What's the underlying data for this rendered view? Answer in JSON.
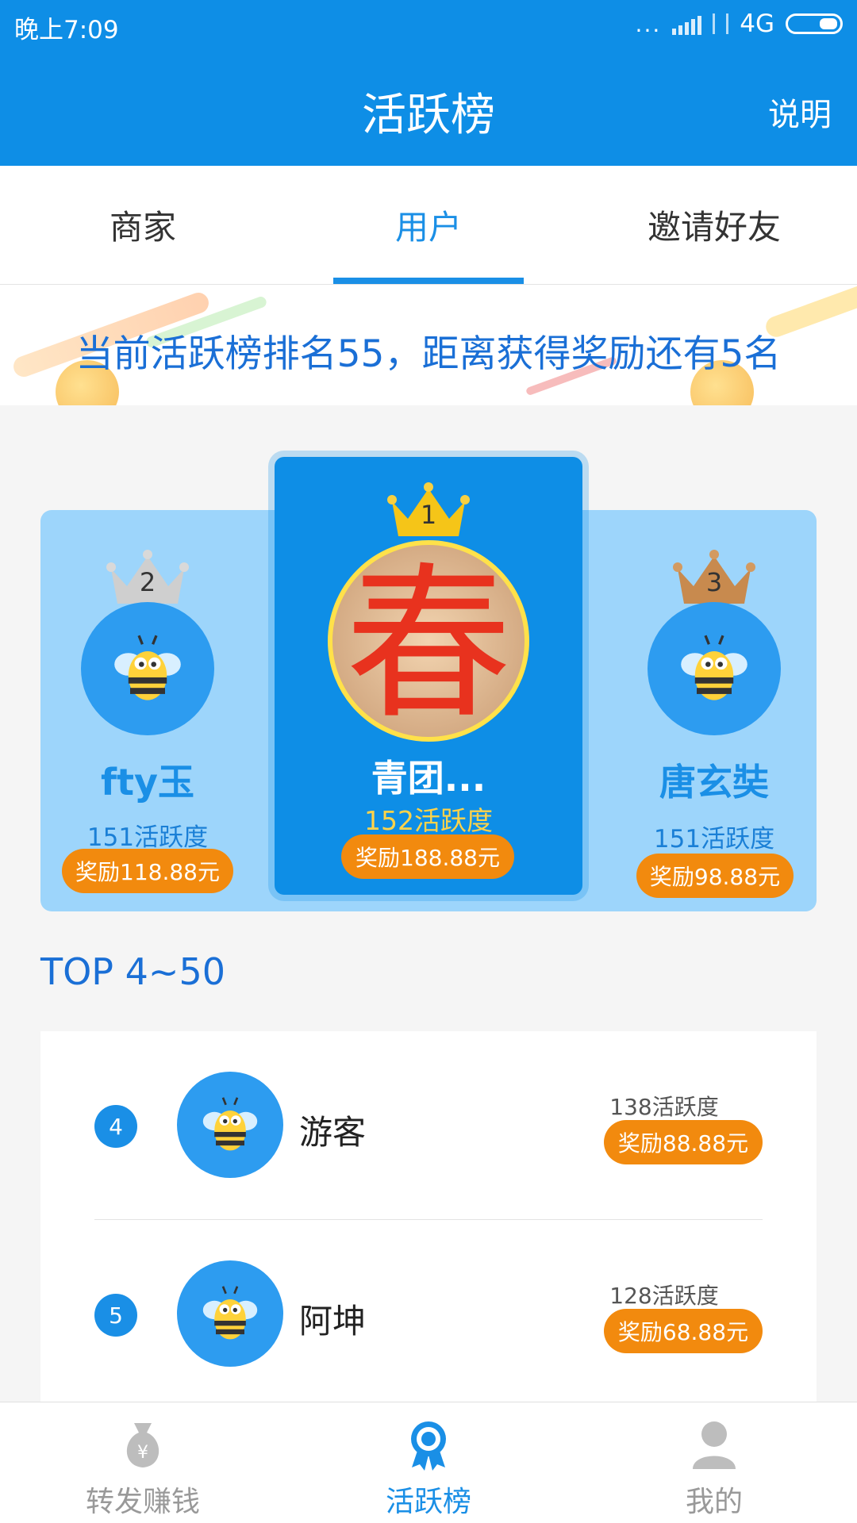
{
  "status_bar": {
    "time": "晚上7:09",
    "dots": "...",
    "network": "4G"
  },
  "header": {
    "title": "活跃榜",
    "action": "说明"
  },
  "tabs": [
    {
      "label": "商家",
      "active": false
    },
    {
      "label": "用户",
      "active": true
    },
    {
      "label": "邀请好友",
      "active": false
    }
  ],
  "banner": {
    "text": "当前活跃榜排名55，距离获得奖励还有5名"
  },
  "podium": {
    "first": {
      "rank": "1",
      "name": "青团...",
      "activity": "152活跃度",
      "reward": "奖励188.88元",
      "avatar": "chun-avatar",
      "avatar_text": "春"
    },
    "second": {
      "rank": "2",
      "name": "fty玉",
      "activity": "151活跃度",
      "reward": "奖励118.88元",
      "avatar": "bee-avatar"
    },
    "third": {
      "rank": "3",
      "name": "唐玄奘",
      "activity": "151活跃度",
      "reward": "奖励98.88元",
      "avatar": "bee-avatar"
    }
  },
  "top_list": {
    "title": "TOP 4~50",
    "rows": [
      {
        "rank": "4",
        "name": "游客",
        "activity": "138活跃度",
        "reward": "奖励88.88元",
        "avatar": "bee-avatar"
      },
      {
        "rank": "5",
        "name": "阿坤",
        "activity": "128活跃度",
        "reward": "奖励68.88元",
        "avatar": "bee-avatar"
      }
    ]
  },
  "bottom_nav": [
    {
      "label": "转发赚钱",
      "icon": "money-bag-icon",
      "active": false
    },
    {
      "label": "活跃榜",
      "icon": "medal-icon",
      "active": true
    },
    {
      "label": "我的",
      "icon": "user-icon",
      "active": false
    }
  ],
  "colors": {
    "primary": "#0e8ee6",
    "accent_orange": "#f28a0e",
    "podium_bg": "#9dd5fb",
    "gold_crown": "#f5c518",
    "silver_crown": "#c9c9c9",
    "bronze_crown": "#c88a4e"
  }
}
